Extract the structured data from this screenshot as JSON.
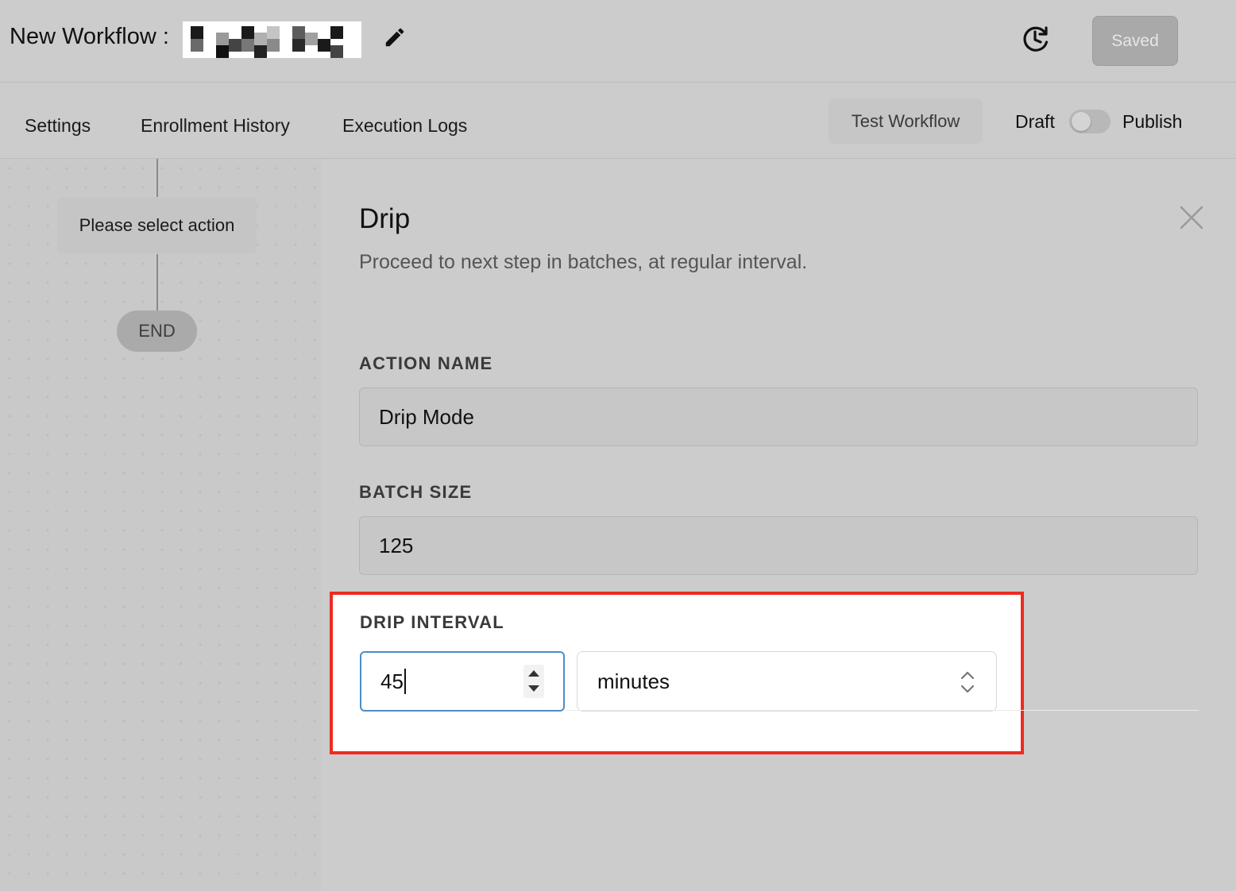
{
  "header": {
    "title_prefix": "New Workflow :",
    "saved_label": "Saved"
  },
  "tabs": {
    "settings": "Settings",
    "enrollment_history": "Enrollment History",
    "execution_logs": "Execution Logs"
  },
  "actions": {
    "test_workflow": "Test Workflow",
    "draft_label": "Draft",
    "publish_label": "Publish",
    "publish_toggle_on": false
  },
  "canvas": {
    "action_node": "Please select action",
    "end_node": "END"
  },
  "panel": {
    "title": "Drip",
    "description": "Proceed to next step in batches, at regular interval.",
    "action_name": {
      "label": "ACTION NAME",
      "value": "Drip Mode"
    },
    "batch_size": {
      "label": "BATCH SIZE",
      "value": "125"
    },
    "drip_interval": {
      "label": "DRIP INTERVAL",
      "value": "45",
      "unit": "minutes"
    }
  },
  "colors": {
    "highlight_border": "#ee2b20",
    "focus_border": "#4b8ec8"
  },
  "icons": [
    "pencil-icon",
    "history-icon",
    "close-icon",
    "chevron-updown-icon"
  ]
}
